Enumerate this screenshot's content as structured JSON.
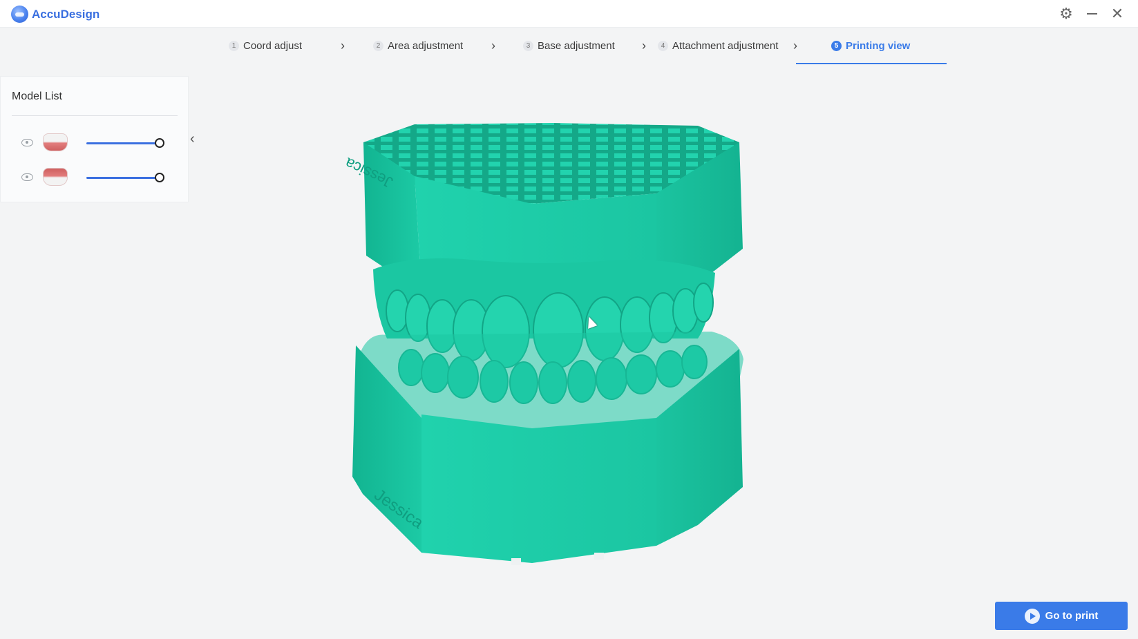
{
  "app": {
    "name": "AccuDesign"
  },
  "steps": [
    {
      "num": "1",
      "label": "Coord adjust"
    },
    {
      "num": "2",
      "label": "Area adjustment"
    },
    {
      "num": "3",
      "label": "Base adjustment"
    },
    {
      "num": "4",
      "label": "Attachment adjustment"
    },
    {
      "num": "5",
      "label": "Printing view",
      "active": true
    }
  ],
  "model_list": {
    "title": "Model List",
    "items": [
      {
        "name": "upper-jaw",
        "visible": true,
        "opacity": 1.0
      },
      {
        "name": "lower-jaw",
        "visible": true,
        "opacity": 1.0
      }
    ]
  },
  "viewport": {
    "model_color": "#1ec7a6",
    "engraving_top": "Jessica",
    "engraving_bottom": "Jessica"
  },
  "actions": {
    "go_to_print": "Go to print"
  },
  "colors": {
    "accent": "#3a7be8",
    "brand": "#3a6fe0",
    "model": "#1ec7a6"
  },
  "icons": [
    "gear-icon",
    "minimize-icon",
    "close-icon",
    "eye-icon",
    "chevron-left-icon",
    "play-icon"
  ]
}
